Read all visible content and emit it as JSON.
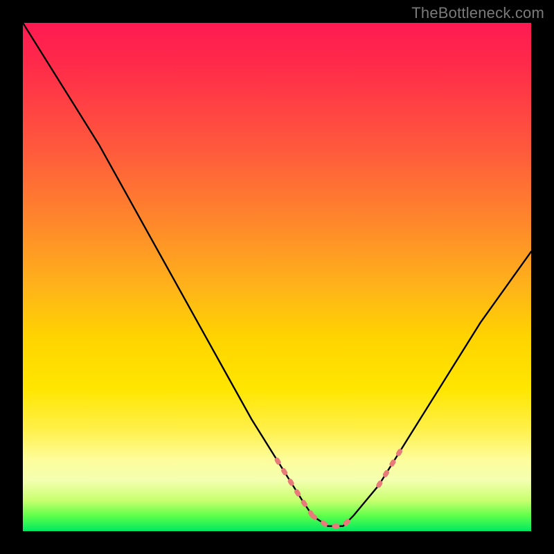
{
  "watermark": "TheBottleneck.com",
  "colors": {
    "frame": "#000000",
    "curve": "#000000",
    "dotted": "#e97a7a",
    "gradient_top": "#ff1a52",
    "gradient_bottom": "#00e860"
  },
  "chart_data": {
    "type": "line",
    "title": "",
    "xlabel": "",
    "ylabel": "",
    "xlim": [
      0,
      100
    ],
    "ylim": [
      0,
      100
    ],
    "series": [
      {
        "name": "bottleneck-curve",
        "x": [
          0,
          5,
          10,
          15,
          20,
          25,
          30,
          35,
          40,
          45,
          50,
          55,
          57,
          60,
          63,
          65,
          70,
          75,
          80,
          85,
          90,
          95,
          100
        ],
        "y": [
          100,
          92,
          84,
          76,
          67,
          58,
          49,
          40,
          31,
          22,
          14,
          6,
          3,
          1,
          1,
          3,
          9,
          17,
          25,
          33,
          41,
          48,
          55
        ]
      }
    ],
    "annotations": [
      {
        "name": "dotted-left-segment",
        "style": "dotted",
        "x": [
          50,
          55,
          57
        ],
        "y": [
          14,
          6,
          3
        ]
      },
      {
        "name": "dotted-valley-segment",
        "style": "dotted",
        "x": [
          57,
          60,
          63,
          65
        ],
        "y": [
          3,
          1,
          1,
          3
        ]
      },
      {
        "name": "dotted-right-segment",
        "style": "dotted",
        "x": [
          70,
          75
        ],
        "y": [
          9,
          17
        ]
      }
    ]
  }
}
